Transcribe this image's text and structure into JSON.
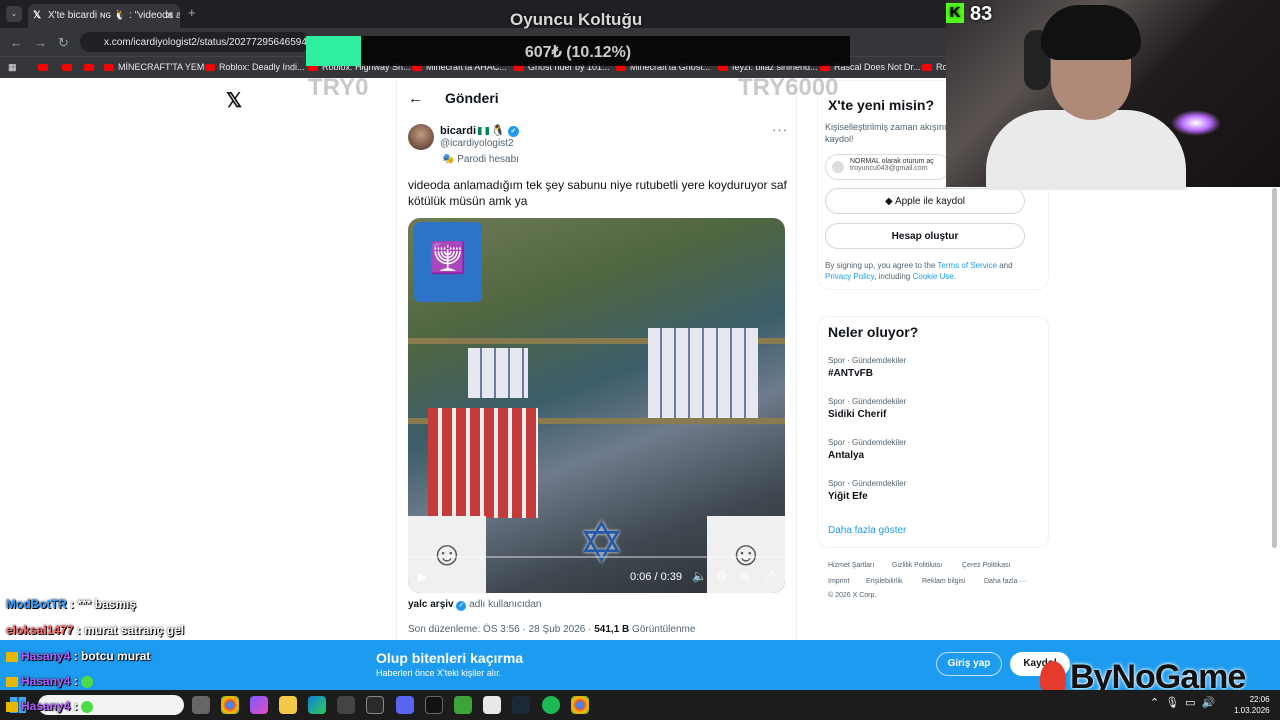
{
  "browser": {
    "tab_title": "X'te bicardi ɴɢ 🐧 : \"videoda anl",
    "url": "x.com/icardiyologist2/status/2027729564659486",
    "bookmarks": [
      "MİNECRAFT'TA YEM...",
      "Roblox: Deadly Indi...",
      "Roblox: Highway Sh...",
      "Minecraft'ta AHAC...",
      "Ghost rider by 101...",
      "Minecraft'ta Ghost...",
      "feyzi: bilaz sinirlerid...",
      "Rascal Does Not Dr...",
      "Ro"
    ]
  },
  "overlay": {
    "title": "Oyuncu Koltuğu",
    "progress_text": "607₺ (10.12%)",
    "progress_fraction": 0.1012,
    "progress_color": "#2ef0a0",
    "goal_start": "TRY0",
    "goal_end": "TRY6000",
    "viewer_count": "83"
  },
  "post": {
    "header": "Gönderi",
    "author": "bicardi",
    "handle": "@icardiyologist2",
    "label": "Parodi hesabı",
    "text": "videoda anlamadığım tek şey sabunu niye rutubetli yere koyduruyor saf kötülük müsün amk ya",
    "video_time": "0:06 / 0:39",
    "source_user": "yalc arşiv",
    "source_suffix": "adlı kullanıcıdan",
    "edited": "Son düzenleme: ÖS 3:56 · 28 Şub 2026 ·",
    "views_count": "541,1 B",
    "views_label": "Görüntülenme"
  },
  "join": {
    "title": "X'te yeni misin?",
    "subtitle": "Kişiselleştirilmiş zaman akışını kaydol!",
    "google_line1": "NORMAL olarak oturum aç",
    "google_line2": "troyuncu043@gmail.com",
    "apple_button": "Apple ile kaydol",
    "create_button": "Hesap oluştur",
    "terms_prefix": "By signing up, you agree to the",
    "terms_link": "Terms of Service",
    "terms_and": "and",
    "privacy_link": "Privacy Policy",
    "including": ", including",
    "cookie_link": "Cookie Use",
    "period": "."
  },
  "trends": {
    "title": "Neler oluyor?",
    "items": [
      {
        "category": "Spor · Gündemdekiler",
        "name": "#ANTvFB"
      },
      {
        "category": "Spor · Gündemdekiler",
        "name": "Sidiki Cherif"
      },
      {
        "category": "Spor · Gündemdekiler",
        "name": "Antalya"
      },
      {
        "category": "Spor · Gündemdekiler",
        "name": "Yiğit Efe"
      }
    ],
    "show_more": "Daha fazla göster"
  },
  "footer": {
    "links": [
      "Hizmet Şartları",
      "Gizlilik Politikası",
      "Çerez Politikası",
      "Imprint",
      "Erişilebilirlik",
      "Reklam bilgisi",
      "Daha fazla ···"
    ],
    "copyright": "© 2026 X Corp."
  },
  "banner": {
    "title": "Olup bitenleri kaçırma",
    "subtitle": "Haberleri önce X'teki kişiler alır.",
    "login": "Giriş yap",
    "signup": "Kaydol"
  },
  "brand": "ByNoGame",
  "chat": [
    {
      "user": "ModBotTR",
      "message": ": *** basmış",
      "color": "#3aa0ff"
    },
    {
      "user": "eloksal1477",
      "message": ": murat satranç gel",
      "color": "#ff6b6b"
    },
    {
      "user": "Hasany4",
      "message": ": botcu murat",
      "color": "#b45cff"
    },
    {
      "user": "Hasany4",
      "message": ":",
      "color": "#b45cff"
    },
    {
      "user": "Hasany4",
      "message": ":",
      "color": "#b45cff"
    }
  ],
  "clock": {
    "time": "22:06",
    "date": "1.03.2026"
  }
}
